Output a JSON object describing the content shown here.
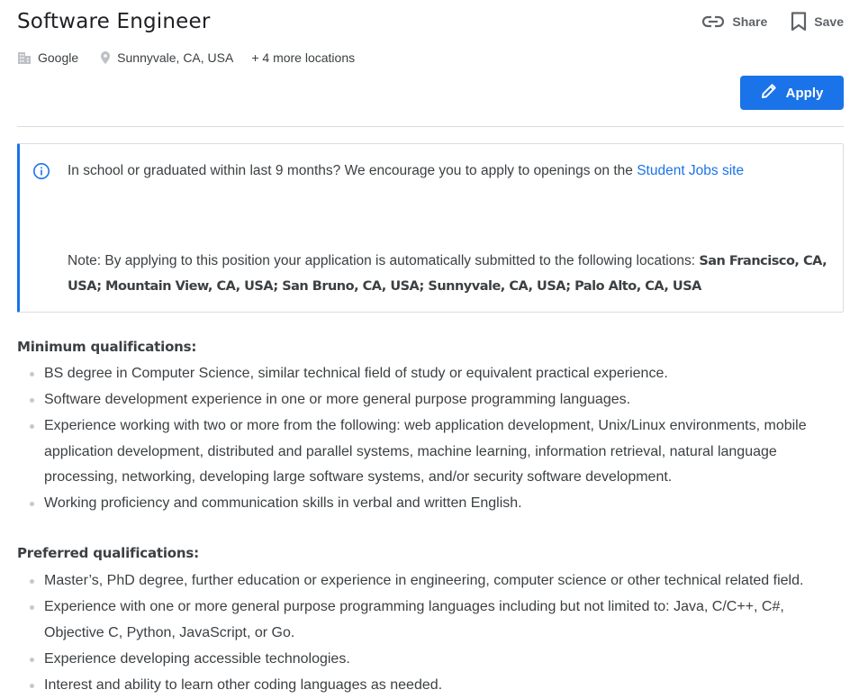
{
  "job": {
    "title": "Software Engineer",
    "company": "Google",
    "location": "Sunnyvale, CA, USA",
    "more_locations": "+ 4 more locations"
  },
  "actions": {
    "share_label": "Share",
    "save_label": "Save",
    "apply_label": "Apply"
  },
  "notice": {
    "text": "In school or graduated within last 9 months? We encourage you to apply to openings on the ",
    "link_text": "Student Jobs site",
    "note_prefix": "Note: By applying to this position your application is automatically submitted to the following locations: ",
    "note_locations": "San Francisco, CA, USA; Mountain View, CA, USA; San Bruno, CA, USA; Sunnyvale, CA, USA; Palo Alto, CA, USA"
  },
  "minimum": {
    "heading": "Minimum qualifications:",
    "items": [
      "BS degree in Computer Science, similar technical field of study or equivalent practical experience.",
      "Software development experience in one or more general purpose programming languages.",
      "Experience working with two or more from the following: web application development, Unix/Linux environments, mobile application development, distributed and parallel systems, machine learning, information retrieval, natural language processing, networking, developing large software systems, and/or security software development.",
      "Working proficiency and communication skills in verbal and written English."
    ]
  },
  "preferred": {
    "heading": "Preferred qualifications:",
    "items": [
      "Master’s, PhD degree, further education or experience in engineering, computer science or other technical related field.",
      "Experience with one or more general purpose programming languages including but not limited to: Java, C/C++, C#, Objective C, Python, JavaScript, or Go.",
      "Experience developing accessible technologies.",
      "Interest and ability to learn other coding languages as needed."
    ]
  },
  "colors": {
    "accent": "#1a73e8",
    "text": "#3c4043",
    "muted": "#5f6368",
    "divider": "#dadce0"
  },
  "icons": {
    "share": "link-icon",
    "save": "bookmark-icon",
    "company": "building-icon",
    "location": "location-pin-icon",
    "apply": "pencil-icon",
    "info": "info-icon"
  }
}
